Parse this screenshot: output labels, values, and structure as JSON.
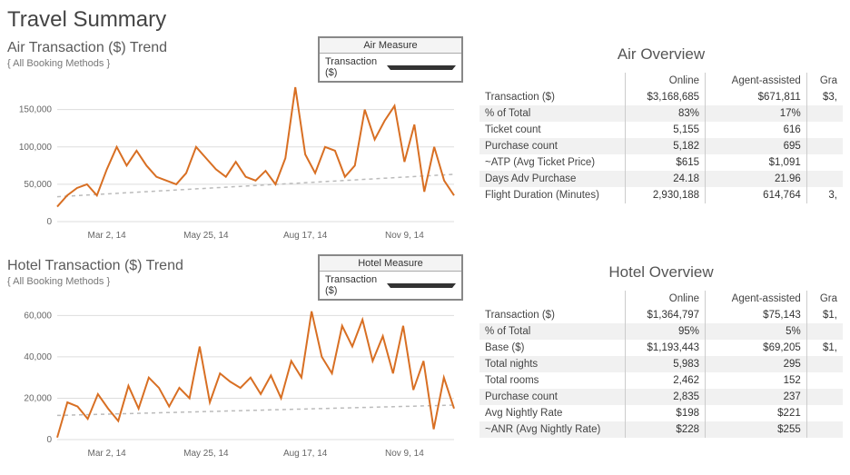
{
  "title": "Travel Summary",
  "air": {
    "chart_title": "Air Transaction ($) Trend",
    "subtitle": "{ All Booking Methods }",
    "dropdown_label": "Air Measure",
    "dropdown_value": "Transaction ($)",
    "ov_title": "Air Overview",
    "cols": [
      "Online",
      "Agent-assisted",
      "Gra"
    ],
    "rows": [
      {
        "label": "Transaction ($)",
        "v": [
          "$3,168,685",
          "$671,811",
          "$3,"
        ]
      },
      {
        "label": "% of Total",
        "v": [
          "83%",
          "17%",
          ""
        ]
      },
      {
        "label": "Ticket count",
        "v": [
          "5,155",
          "616",
          ""
        ]
      },
      {
        "label": "Purchase count",
        "v": [
          "5,182",
          "695",
          ""
        ]
      },
      {
        "label": "~ATP (Avg Ticket Price)",
        "v": [
          "$615",
          "$1,091",
          ""
        ]
      },
      {
        "label": "Days Adv Purchase",
        "v": [
          "24.18",
          "21.96",
          ""
        ]
      },
      {
        "label": "Flight Duration (Minutes)",
        "v": [
          "2,930,188",
          "614,764",
          "3,"
        ]
      }
    ]
  },
  "hotel": {
    "chart_title": "Hotel Transaction ($) Trend",
    "subtitle": "{ All Booking Methods }",
    "dropdown_label": "Hotel Measure",
    "dropdown_value": "Transaction ($)",
    "ov_title": "Hotel Overview",
    "cols": [
      "Online",
      "Agent-assisted",
      "Gra"
    ],
    "rows": [
      {
        "label": "Transaction ($)",
        "v": [
          "$1,364,797",
          "$75,143",
          "$1,"
        ]
      },
      {
        "label": "% of Total",
        "v": [
          "95%",
          "5%",
          ""
        ]
      },
      {
        "label": "Base ($)",
        "v": [
          "$1,193,443",
          "$69,205",
          "$1,"
        ]
      },
      {
        "label": "Total nights",
        "v": [
          "5,983",
          "295",
          ""
        ]
      },
      {
        "label": "Total rooms",
        "v": [
          "2,462",
          "152",
          ""
        ]
      },
      {
        "label": "Purchase count",
        "v": [
          "2,835",
          "237",
          ""
        ]
      },
      {
        "label": "Avg Nightly Rate",
        "v": [
          "$198",
          "$221",
          ""
        ]
      },
      {
        "label": "~ANR (Avg Nightly Rate)",
        "v": [
          "$228",
          "$255",
          ""
        ]
      }
    ]
  },
  "x_ticks": [
    "Mar 2, 14",
    "May 25, 14",
    "Aug 17, 14",
    "Nov 9, 14"
  ],
  "chart_data": [
    {
      "type": "line",
      "title": "Air Transaction ($) Trend",
      "xlabel": "",
      "ylabel": "",
      "ylim": [
        0,
        180000
      ],
      "y_ticks": [
        0,
        50000,
        100000,
        150000
      ],
      "x_ticks": [
        "Mar 2, 14",
        "May 25, 14",
        "Aug 17, 14",
        "Nov 9, 14"
      ],
      "series": [
        {
          "name": "Transaction ($)",
          "values": [
            20000,
            35000,
            45000,
            50000,
            35000,
            70000,
            100000,
            75000,
            95000,
            75000,
            60000,
            55000,
            50000,
            65000,
            100000,
            85000,
            70000,
            60000,
            80000,
            60000,
            55000,
            68000,
            50000,
            85000,
            180000,
            90000,
            65000,
            100000,
            95000,
            60000,
            75000,
            150000,
            110000,
            135000,
            155000,
            80000,
            130000,
            40000,
            100000,
            55000,
            35000
          ]
        }
      ]
    },
    {
      "type": "line",
      "title": "Hotel Transaction ($) Trend",
      "xlabel": "",
      "ylabel": "",
      "ylim": [
        0,
        65000
      ],
      "y_ticks": [
        0,
        20000,
        40000,
        60000
      ],
      "x_ticks": [
        "Mar 2, 14",
        "May 25, 14",
        "Aug 17, 14",
        "Nov 9, 14"
      ],
      "series": [
        {
          "name": "Transaction ($)",
          "values": [
            1000,
            18000,
            16000,
            10000,
            22000,
            15000,
            9000,
            26000,
            15000,
            30000,
            25000,
            16000,
            25000,
            20000,
            45000,
            18000,
            32000,
            28000,
            25000,
            30000,
            22000,
            31000,
            20000,
            38000,
            30000,
            62000,
            40000,
            32000,
            55000,
            45000,
            58000,
            38000,
            50000,
            32000,
            55000,
            24000,
            38000,
            5000,
            30000,
            15000
          ]
        }
      ]
    }
  ],
  "colors": {
    "line": "#d86f23"
  }
}
